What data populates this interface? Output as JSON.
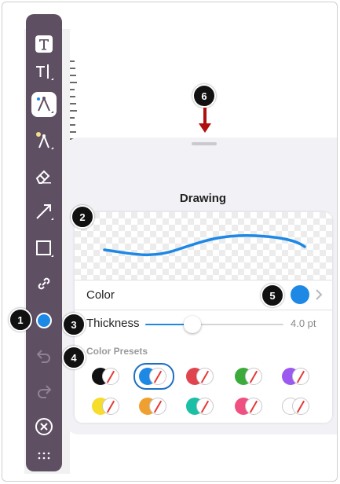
{
  "sheet": {
    "title": "Drawing",
    "color_label": "Color",
    "thickness_label": "Thickness",
    "thickness_value": "4.0 pt",
    "thickness_fraction": 0.34,
    "presets_label": "Color Presets",
    "current_color": "#1e88e5"
  },
  "toolbar": {
    "tools": [
      "text-box-tool",
      "text-tool",
      "pen-tool",
      "highlighter-tool",
      "eraser-tool",
      "arrow-tool",
      "rectangle-tool",
      "link-tool",
      "color-tool",
      "undo",
      "redo",
      "close",
      "more"
    ]
  },
  "presets": [
    {
      "color": "#111111",
      "selected": false
    },
    {
      "color": "#1e88e5",
      "selected": true
    },
    {
      "color": "#e0454f",
      "selected": false
    },
    {
      "color": "#3cab3c",
      "selected": false
    },
    {
      "color": "#9b59f0",
      "selected": false
    },
    {
      "color": "#f5dd2a",
      "selected": false
    },
    {
      "color": "#f0a030",
      "selected": false
    },
    {
      "color": "#1bbfa5",
      "selected": false
    },
    {
      "color": "#f0507f",
      "selected": false
    },
    {
      "color": "#ffffff",
      "selected": false
    }
  ],
  "callouts": [
    "1",
    "2",
    "3",
    "4",
    "5",
    "6"
  ]
}
